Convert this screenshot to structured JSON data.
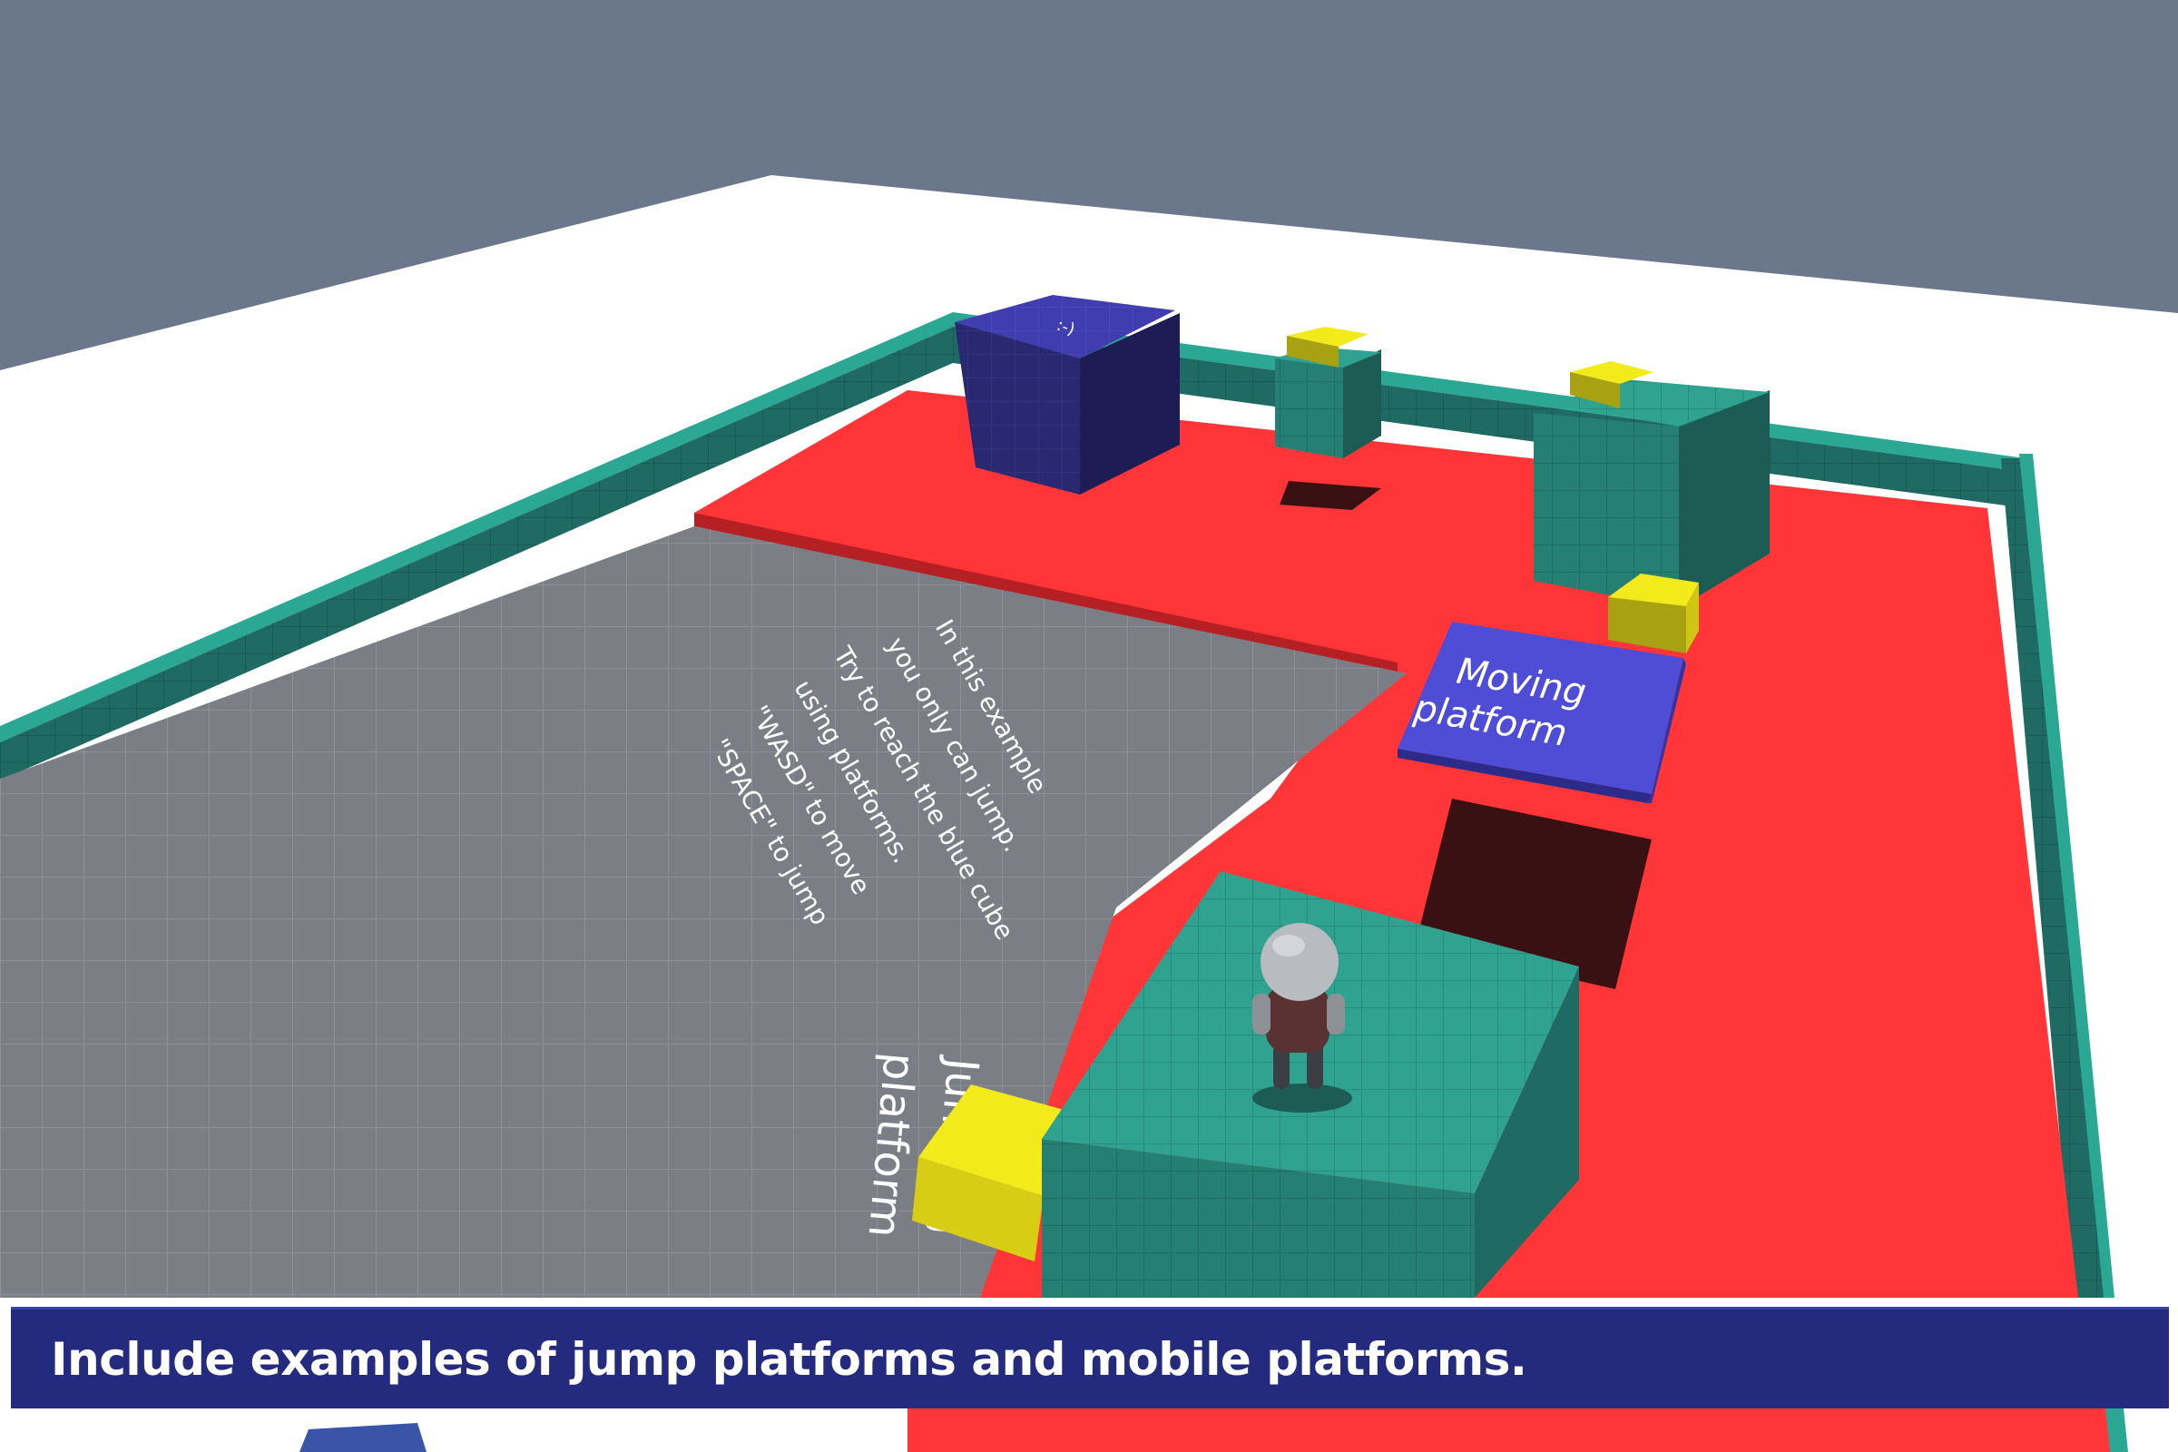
{
  "scene": {
    "sky_color": "#6b778a",
    "ground_color": "#ffffff",
    "wall_color": "#2aa894",
    "red_zone_color": "#ff3538",
    "floor_color": "#7b7e85",
    "blue_cube_color": "#3d3aa8",
    "yellow_pad_color": "#f2ea1a",
    "teal_block_color": "#2fa390"
  },
  "floor_instructions": {
    "lines": [
      "In this example",
      "you only can jump.",
      "Try to reach the blue cube",
      "using platforms.",
      "\"WASD\" to move",
      "\"SPACE\" to jump"
    ]
  },
  "blue_cube": {
    "face_glyph": ":-)"
  },
  "moving_platform": {
    "line1": "Moving",
    "line2": "platform"
  },
  "jumping_platform": {
    "line1": "Jumping",
    "line2": "platform"
  },
  "caption": {
    "text": "Include examples of jump platforms and mobile platforms."
  }
}
